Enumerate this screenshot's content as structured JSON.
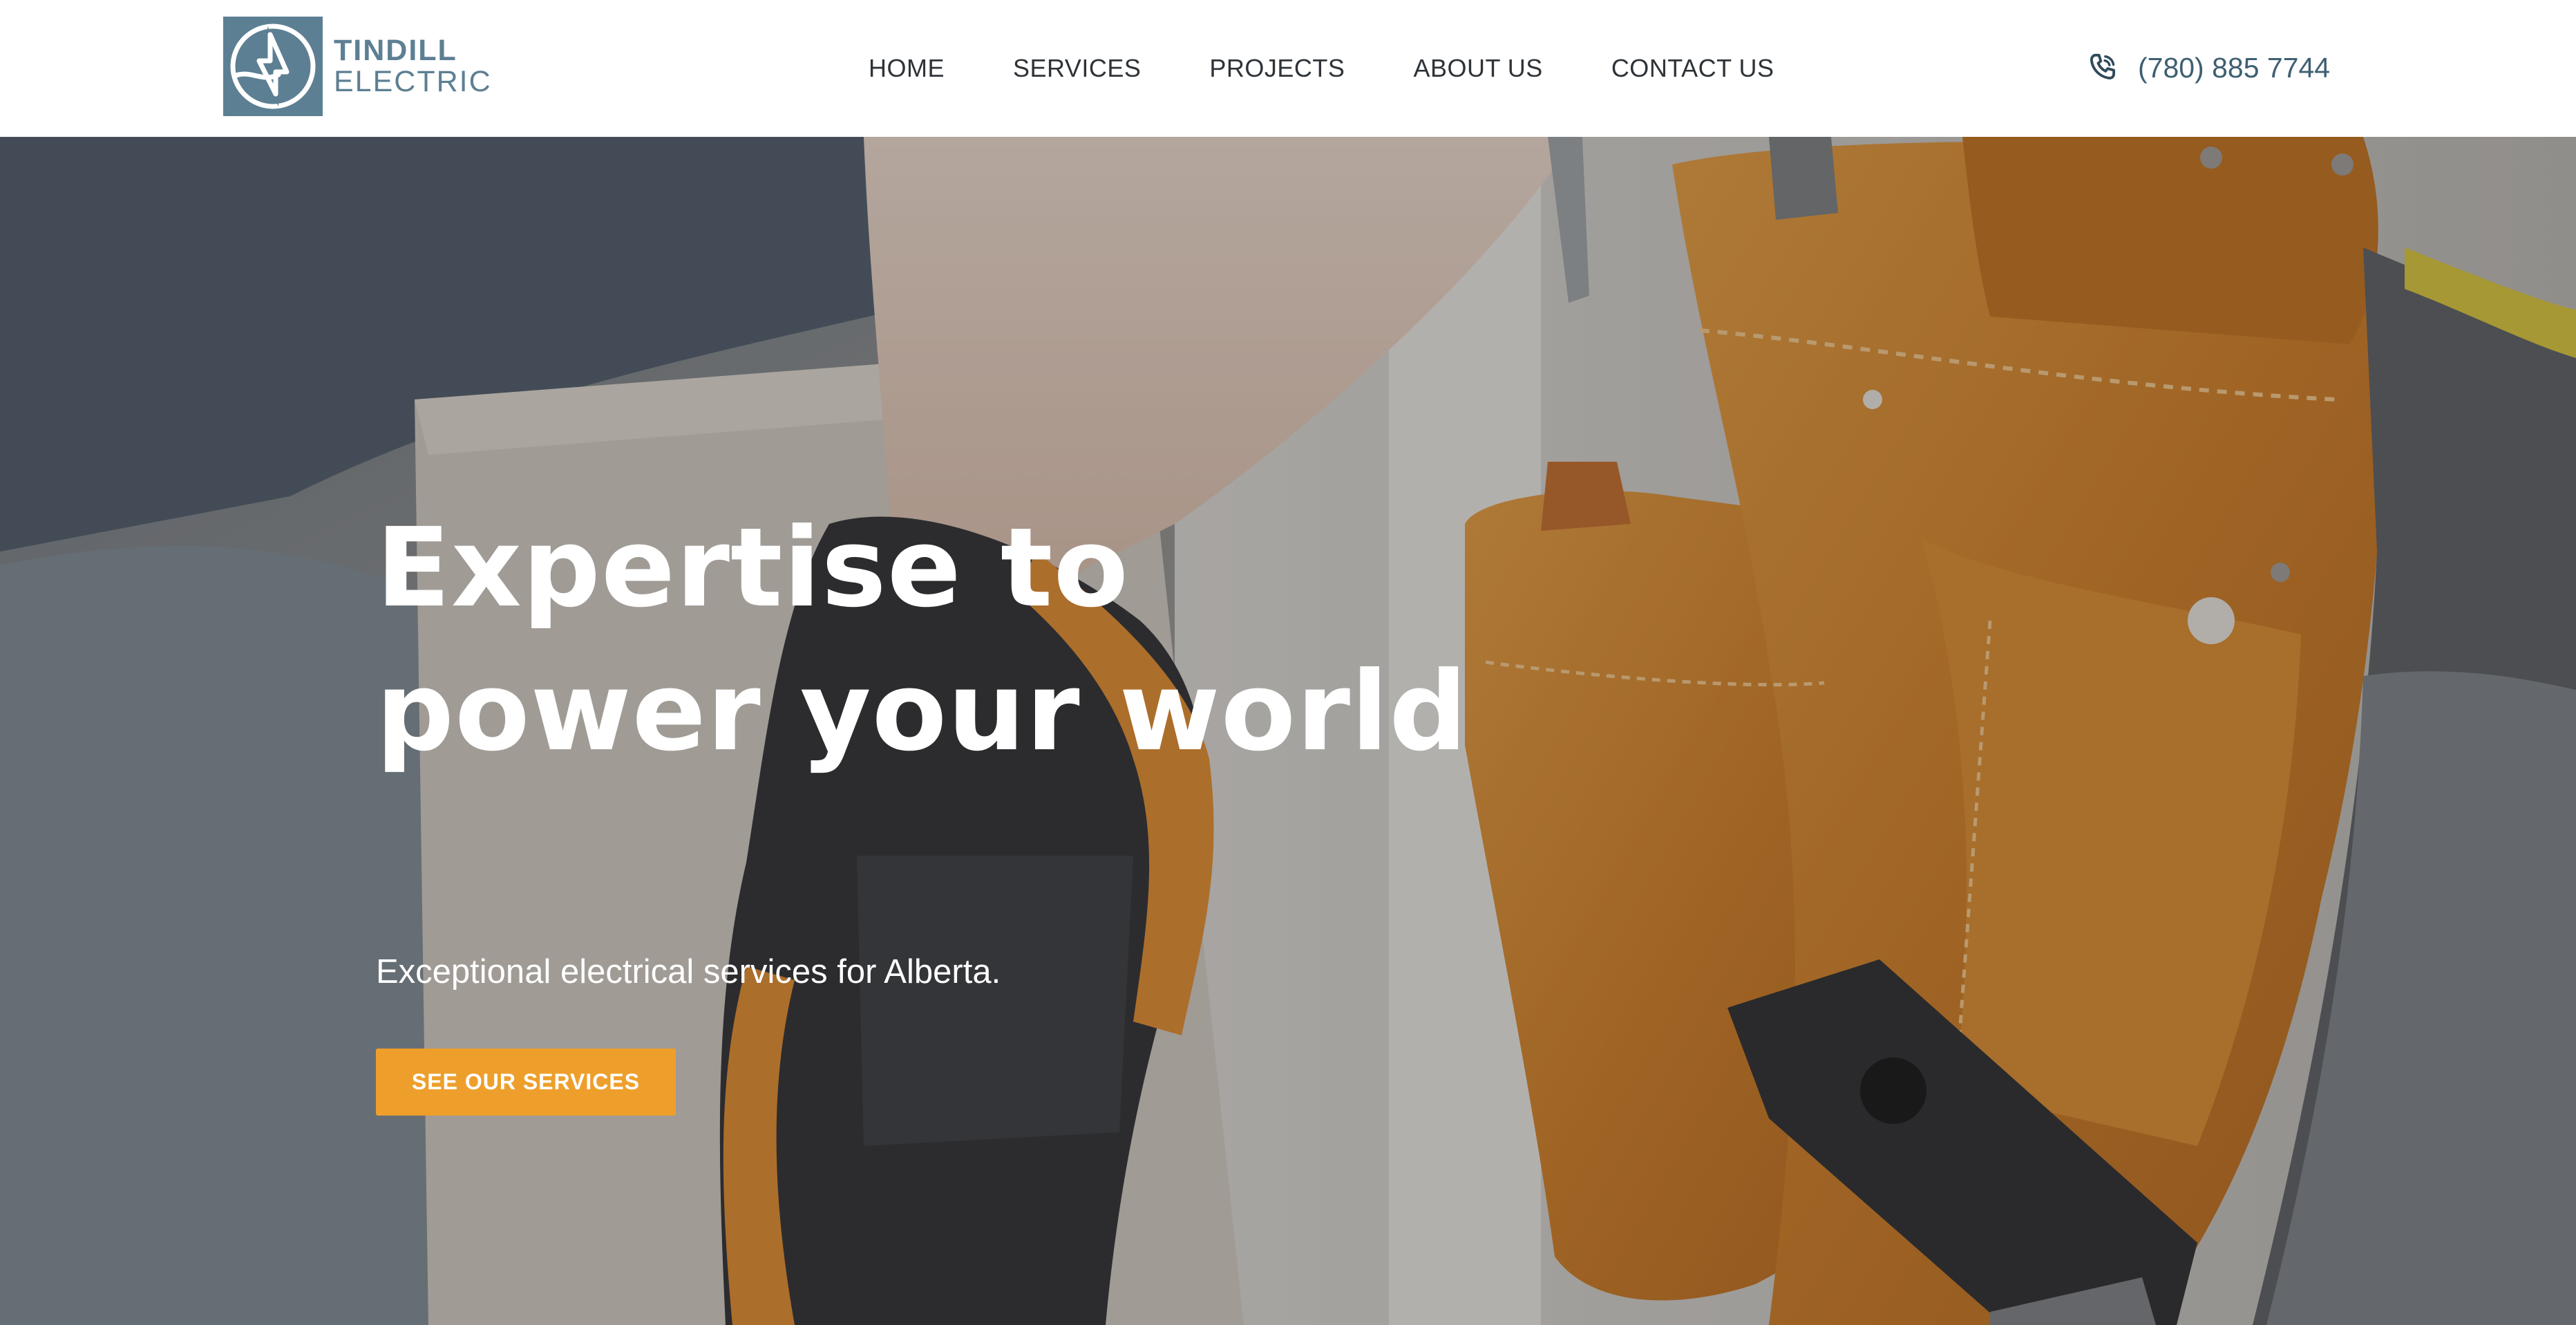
{
  "brand": {
    "name_line1": "TINDILL",
    "name_line2": "ELECTRIC",
    "color": "#5d7f93",
    "logo_icon": "lightning-bolt-icon"
  },
  "nav": {
    "items": [
      {
        "label": "HOME"
      },
      {
        "label": "SERVICES"
      },
      {
        "label": "PROJECTS"
      },
      {
        "label": "ABOUT US"
      },
      {
        "label": "CONTACT US"
      }
    ]
  },
  "contact": {
    "phone_icon": "phone-icon",
    "phone": "(780) 885 7744",
    "color": "#3e5f72"
  },
  "hero": {
    "title": "Expertise to power your world",
    "subtitle": "Exceptional electrical services for Alberta.",
    "cta_label": "SEE OUR SERVICES",
    "cta_color": "#ee9f2b",
    "background": "photo of an electrician's gloved hand and leather tool belt"
  }
}
